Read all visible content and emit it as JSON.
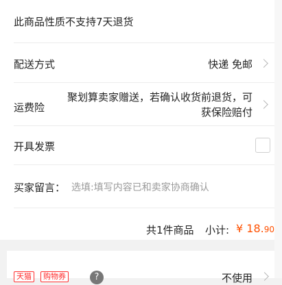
{
  "notice": "此商品性质不支持7天退货",
  "delivery": {
    "label": "配送方式",
    "value": "快递 免邮"
  },
  "shipping_insurance": {
    "label": "运费险",
    "value_line1": "聚划算卖家赠送，若确认收货前退货，可",
    "value_line2": "获保险赔付"
  },
  "invoice": {
    "label": "开具发票",
    "checked": false
  },
  "buyer_message": {
    "label": "买家留言：",
    "placeholder": "选填:填写内容已和卖家协商确认"
  },
  "summary": {
    "count_text": "共1件商品",
    "subtotal_label": "小计:",
    "currency": "¥",
    "amount_integer": "18.",
    "amount_decimal": "90"
  },
  "coupon_row": {
    "badge1": "天猫",
    "badge2": "购物券",
    "help": "?",
    "value": "不使用"
  },
  "colors": {
    "price": "#ff5000",
    "badge": "#ff2d2d"
  },
  "icons": [
    "chevron-right-icon",
    "checkbox-icon",
    "help-icon"
  ]
}
